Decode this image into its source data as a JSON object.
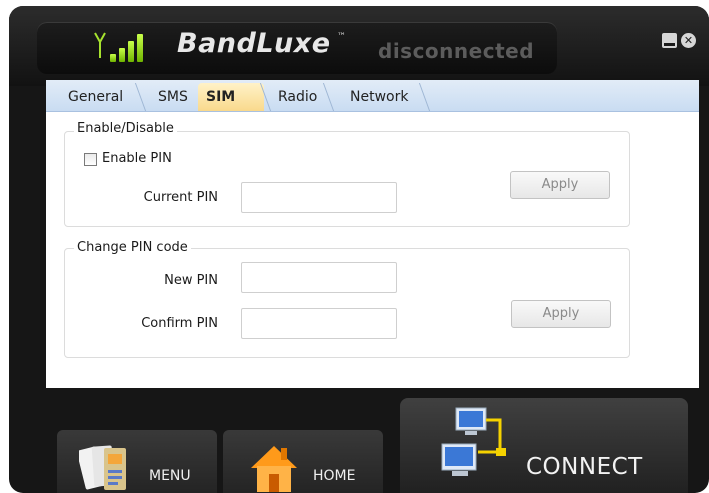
{
  "header": {
    "brand": "BandLuxe",
    "trademark": "™",
    "status": "disconnected",
    "minimize_icon": "minimize-icon",
    "close_icon": "close-icon"
  },
  "tabs": [
    {
      "label": "General",
      "active": false
    },
    {
      "label": "SMS",
      "active": false
    },
    {
      "label": "SIM",
      "active": true
    },
    {
      "label": "Radio",
      "active": false
    },
    {
      "label": "Network",
      "active": false
    }
  ],
  "enable_group": {
    "legend": "Enable/Disable",
    "checkbox_label": "Enable PIN",
    "checked": false,
    "current_pin_label": "Current PIN",
    "current_pin_value": "",
    "apply_label": "Apply"
  },
  "change_group": {
    "legend": "Change PIN code",
    "new_pin_label": "New PIN",
    "new_pin_value": "",
    "confirm_pin_label": "Confirm PIN",
    "confirm_pin_value": "",
    "apply_label": "Apply"
  },
  "footer": {
    "menu_label": "MENU",
    "home_label": "HOME",
    "connect_label": "CONNECT"
  },
  "colors": {
    "signal_green": "#8ed61a",
    "tab_bar": "#c9dcf2",
    "active_tab": "#f9d98c",
    "chrome_dark": "#161616"
  }
}
